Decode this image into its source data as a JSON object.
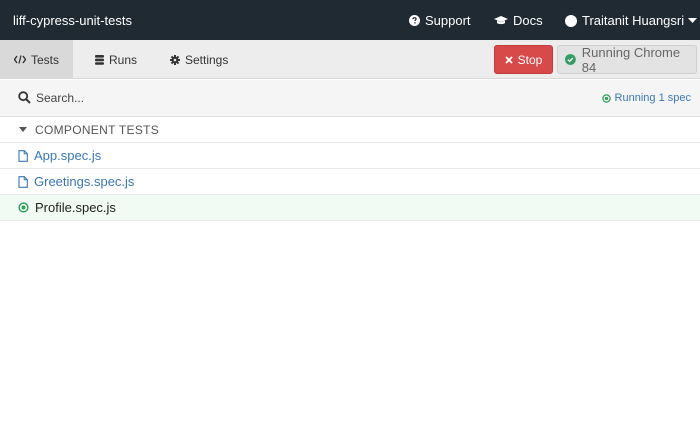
{
  "header": {
    "project_name": "liff-cypress-unit-tests",
    "support_label": "Support",
    "docs_label": "Docs",
    "user_label": "Traitanit Huangsri"
  },
  "nav": {
    "tabs": [
      {
        "label": "Tests",
        "icon": "code-icon",
        "active": true
      },
      {
        "label": "Runs",
        "icon": "database-icon",
        "active": false
      },
      {
        "label": "Settings",
        "icon": "gear-icon",
        "active": false
      }
    ],
    "stop_label": "Stop",
    "browser_label": "Running Chrome 84"
  },
  "search": {
    "placeholder": "Search...",
    "value": "",
    "status_label": "Running 1 spec"
  },
  "specs": {
    "folder_label": "COMPONENT TESTS",
    "files": [
      {
        "label": "App.spec.js",
        "icon": "file-icon",
        "running": false
      },
      {
        "label": "Greetings.spec.js",
        "icon": "file-icon",
        "running": false
      },
      {
        "label": "Profile.spec.js",
        "icon": "running-dot-icon",
        "running": true
      }
    ]
  },
  "colors": {
    "header_bg": "#202a33",
    "link_blue": "#3a78b6",
    "stop_red": "#d84a4a",
    "running_green": "#2e9f5d",
    "active_row_bg": "#f1fbf4"
  }
}
